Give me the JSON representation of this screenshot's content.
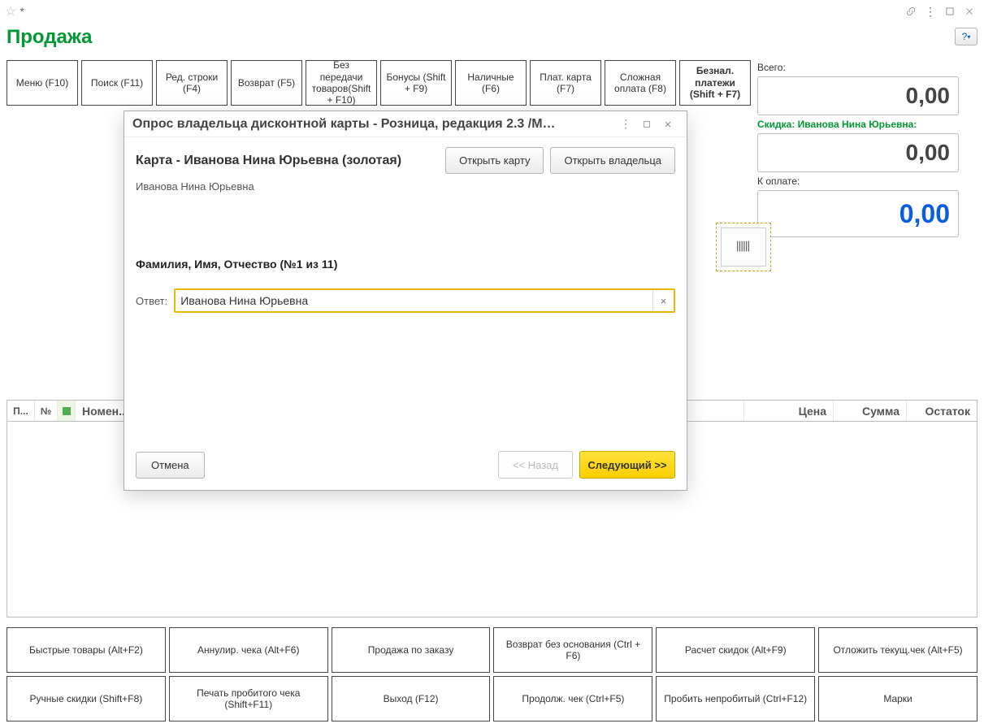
{
  "window": {
    "star": "☆",
    "modified": "*"
  },
  "page_title": "Продажа",
  "toolbar": {
    "menu": "Меню (F10)",
    "search": "Поиск (F11)",
    "edit_row": "Ред. строки (F4)",
    "return": "Возврат (F5)",
    "no_transfer": "Без передачи товаров(Shift + F10)",
    "bonuses": "Бонусы (Shift + F9)",
    "cash": "Наличные (F6)",
    "card": "Плат. карта (F7)",
    "complex": "Сложная оплата (F8)",
    "noncash": "Безнал. платежи (Shift + F7)"
  },
  "totals": {
    "total_label": "Всего:",
    "total_value": "0,00",
    "discount_label": "Скидка: Иванова Нина Юрьевна:",
    "discount_value": "0,00",
    "topay_label": "К оплате:",
    "topay_value": "0,00"
  },
  "grid": {
    "col_p": "П...",
    "col_num": "№",
    "col_nomenclature": "Номен...",
    "col_price": "Цена",
    "col_sum": "Сумма",
    "col_stock": "Остаток"
  },
  "bottom": {
    "row1": {
      "fast_goods": "Быстрые товары (Alt+F2)",
      "void_check": "Аннулир. чека (Alt+F6)",
      "order_sale": "Продажа по заказу",
      "return_no_basis": "Возврат без основания (Ctrl + F6)",
      "discount_calc": "Расчет скидок (Alt+F9)",
      "postpone": "Отложить текущ.чек (Alt+F5)"
    },
    "row2": {
      "manual_discounts": "Ручные скидки (Shift+F8)",
      "print_receipt": "Печать пробитого чека (Shift+F11)",
      "exit": "Выход (F12)",
      "resume_check": "Продолж. чек (Ctrl+F5)",
      "punch_unpunch": "Пробить непробитый (Ctrl+F12)",
      "marks": "Марки"
    }
  },
  "modal": {
    "title": "Опрос владельца дисконтной карты - Розница, редакция 2.3 /М…",
    "card_title": "Карта - Иванова Нина Юрьевна (золотая)",
    "open_card": "Открыть карту",
    "open_owner": "Открыть владельца",
    "owner_name": "Иванова Нина Юрьевна",
    "question": "Фамилия, Имя, Отчество (№1 из 11)",
    "answer_label": "Ответ:",
    "answer_value": "Иванова Нина Юрьевна",
    "cancel": "Отмена",
    "back": "<< Назад",
    "next": "Следующий >>"
  }
}
